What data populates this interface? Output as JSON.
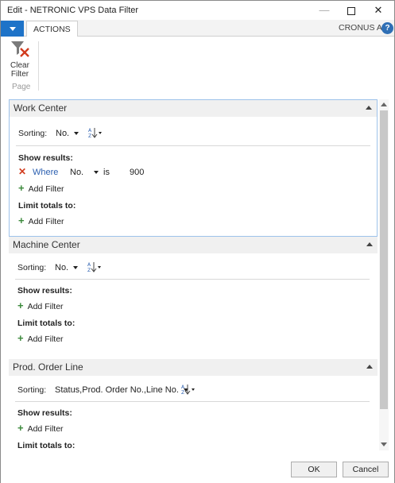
{
  "window": {
    "title": "Edit - NETRONIC VPS Data Filter",
    "minimize_glyph": "—",
    "close_glyph": "✕"
  },
  "ribbon": {
    "tab_actions": "ACTIONS",
    "company": "CRONUS AG",
    "help_glyph": "?",
    "clear_filter_line1": "Clear",
    "clear_filter_line2": "Filter",
    "group_label": "Page"
  },
  "sections": {
    "work_center": {
      "title": "Work Center",
      "sorting_label": "Sorting:",
      "sorting_value": "No.",
      "show_results_label": "Show results:",
      "filter_where": "Where",
      "filter_field": "No.",
      "filter_operator": "is",
      "filter_value": "900",
      "add_filter_label": "Add Filter",
      "limit_totals_label": "Limit totals to:",
      "limit_add_filter_label": "Add Filter"
    },
    "machine_center": {
      "title": "Machine Center",
      "sorting_label": "Sorting:",
      "sorting_value": "No.",
      "show_results_label": "Show results:",
      "add_filter_label": "Add Filter",
      "limit_totals_label": "Limit totals to:",
      "limit_add_filter_label": "Add Filter"
    },
    "prod_order_line": {
      "title": "Prod. Order Line",
      "sorting_label": "Sorting:",
      "sorting_value": "Status,Prod. Order No.,Line No.",
      "show_results_label": "Show results:",
      "add_filter_label": "Add Filter",
      "limit_totals_label": "Limit totals to:"
    }
  },
  "footer": {
    "ok_label": "OK",
    "cancel_label": "Cancel"
  },
  "colors": {
    "accent": "#1e73c8",
    "add_plus": "#3c8a3c",
    "remove_x": "#d13b1e",
    "link": "#2b5fb0",
    "selected_border": "#9dc2ea"
  }
}
